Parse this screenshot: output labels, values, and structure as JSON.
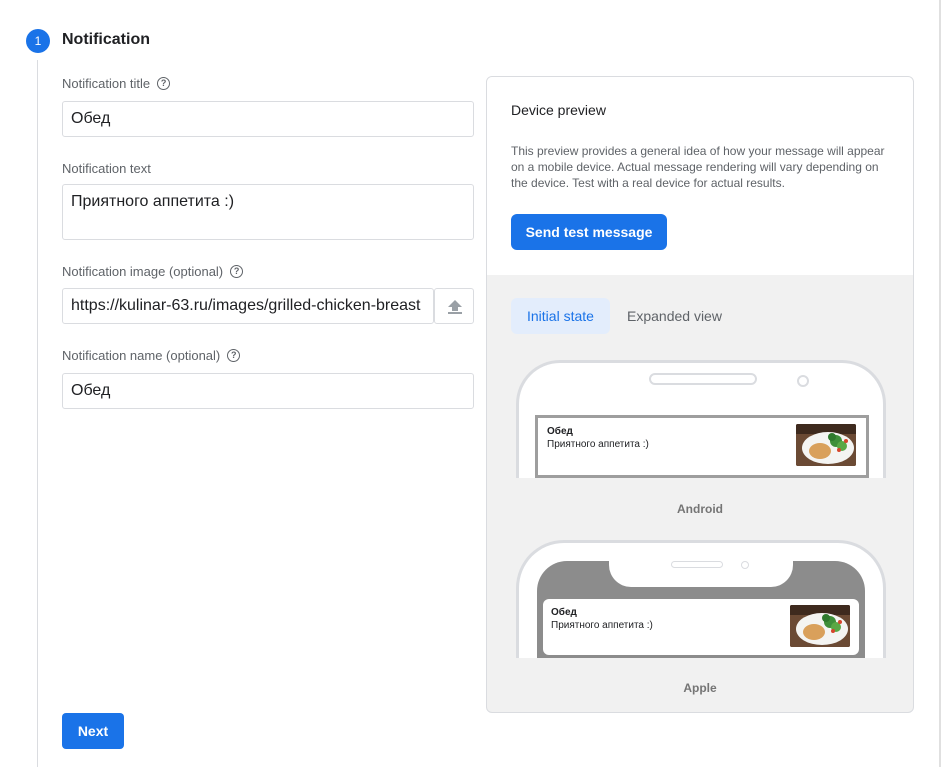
{
  "step": {
    "number": "1",
    "title": "Notification"
  },
  "form": {
    "title_label": "Notification title",
    "title_value": "Обед",
    "text_label": "Notification text",
    "text_value": "Приятного аппетита :)",
    "image_label": "Notification image (optional)",
    "image_value": "https://kulinar-63.ru/images/grilled-chicken-breast",
    "name_label": "Notification name (optional)",
    "name_value": "Обед",
    "help_glyph": "?"
  },
  "next_label": "Next",
  "preview": {
    "title": "Device preview",
    "description": "This preview provides a general idea of how your message will appear on a mobile device. Actual message rendering will vary depending on the device. Test with a real device for actual results.",
    "send_label": "Send test message",
    "tabs": [
      {
        "label": "Initial state",
        "active": true
      },
      {
        "label": "Expanded view",
        "active": false
      }
    ],
    "devices": [
      {
        "label": "Android",
        "notif_title": "Обед",
        "notif_body": "Приятного аппетита :)"
      },
      {
        "label": "Apple",
        "notif_title": "Обед",
        "notif_body": "Приятного аппетита :)"
      }
    ]
  },
  "colors": {
    "accent": "#1a73e8",
    "tab_active_bg": "#e3edfc",
    "panel_bg": "#f1f1f1"
  },
  "icons": [
    "help-icon",
    "upload-icon",
    "food-thumbnail"
  ]
}
